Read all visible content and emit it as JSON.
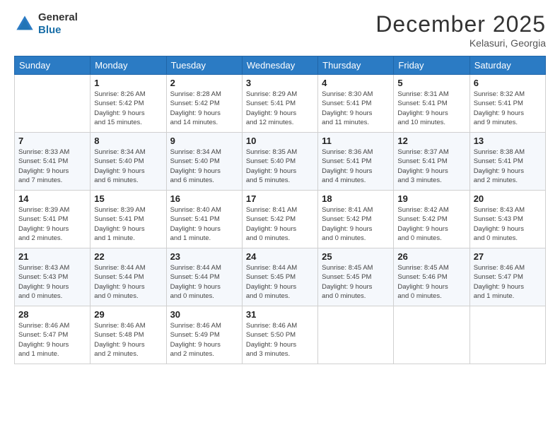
{
  "header": {
    "logo_line1": "General",
    "logo_line2": "Blue",
    "month_title": "December 2025",
    "location": "Kelasuri, Georgia"
  },
  "weekdays": [
    "Sunday",
    "Monday",
    "Tuesday",
    "Wednesday",
    "Thursday",
    "Friday",
    "Saturday"
  ],
  "weeks": [
    [
      {
        "day": "",
        "info": ""
      },
      {
        "day": "1",
        "info": "Sunrise: 8:26 AM\nSunset: 5:42 PM\nDaylight: 9 hours\nand 15 minutes."
      },
      {
        "day": "2",
        "info": "Sunrise: 8:28 AM\nSunset: 5:42 PM\nDaylight: 9 hours\nand 14 minutes."
      },
      {
        "day": "3",
        "info": "Sunrise: 8:29 AM\nSunset: 5:41 PM\nDaylight: 9 hours\nand 12 minutes."
      },
      {
        "day": "4",
        "info": "Sunrise: 8:30 AM\nSunset: 5:41 PM\nDaylight: 9 hours\nand 11 minutes."
      },
      {
        "day": "5",
        "info": "Sunrise: 8:31 AM\nSunset: 5:41 PM\nDaylight: 9 hours\nand 10 minutes."
      },
      {
        "day": "6",
        "info": "Sunrise: 8:32 AM\nSunset: 5:41 PM\nDaylight: 9 hours\nand 9 minutes."
      }
    ],
    [
      {
        "day": "7",
        "info": "Sunrise: 8:33 AM\nSunset: 5:41 PM\nDaylight: 9 hours\nand 7 minutes."
      },
      {
        "day": "8",
        "info": "Sunrise: 8:34 AM\nSunset: 5:40 PM\nDaylight: 9 hours\nand 6 minutes."
      },
      {
        "day": "9",
        "info": "Sunrise: 8:34 AM\nSunset: 5:40 PM\nDaylight: 9 hours\nand 6 minutes."
      },
      {
        "day": "10",
        "info": "Sunrise: 8:35 AM\nSunset: 5:40 PM\nDaylight: 9 hours\nand 5 minutes."
      },
      {
        "day": "11",
        "info": "Sunrise: 8:36 AM\nSunset: 5:41 PM\nDaylight: 9 hours\nand 4 minutes."
      },
      {
        "day": "12",
        "info": "Sunrise: 8:37 AM\nSunset: 5:41 PM\nDaylight: 9 hours\nand 3 minutes."
      },
      {
        "day": "13",
        "info": "Sunrise: 8:38 AM\nSunset: 5:41 PM\nDaylight: 9 hours\nand 2 minutes."
      }
    ],
    [
      {
        "day": "14",
        "info": "Sunrise: 8:39 AM\nSunset: 5:41 PM\nDaylight: 9 hours\nand 2 minutes."
      },
      {
        "day": "15",
        "info": "Sunrise: 8:39 AM\nSunset: 5:41 PM\nDaylight: 9 hours\nand 1 minute."
      },
      {
        "day": "16",
        "info": "Sunrise: 8:40 AM\nSunset: 5:41 PM\nDaylight: 9 hours\nand 1 minute."
      },
      {
        "day": "17",
        "info": "Sunrise: 8:41 AM\nSunset: 5:42 PM\nDaylight: 9 hours\nand 0 minutes."
      },
      {
        "day": "18",
        "info": "Sunrise: 8:41 AM\nSunset: 5:42 PM\nDaylight: 9 hours\nand 0 minutes."
      },
      {
        "day": "19",
        "info": "Sunrise: 8:42 AM\nSunset: 5:42 PM\nDaylight: 9 hours\nand 0 minutes."
      },
      {
        "day": "20",
        "info": "Sunrise: 8:43 AM\nSunset: 5:43 PM\nDaylight: 9 hours\nand 0 minutes."
      }
    ],
    [
      {
        "day": "21",
        "info": "Sunrise: 8:43 AM\nSunset: 5:43 PM\nDaylight: 9 hours\nand 0 minutes."
      },
      {
        "day": "22",
        "info": "Sunrise: 8:44 AM\nSunset: 5:44 PM\nDaylight: 9 hours\nand 0 minutes."
      },
      {
        "day": "23",
        "info": "Sunrise: 8:44 AM\nSunset: 5:44 PM\nDaylight: 9 hours\nand 0 minutes."
      },
      {
        "day": "24",
        "info": "Sunrise: 8:44 AM\nSunset: 5:45 PM\nDaylight: 9 hours\nand 0 minutes."
      },
      {
        "day": "25",
        "info": "Sunrise: 8:45 AM\nSunset: 5:45 PM\nDaylight: 9 hours\nand 0 minutes."
      },
      {
        "day": "26",
        "info": "Sunrise: 8:45 AM\nSunset: 5:46 PM\nDaylight: 9 hours\nand 0 minutes."
      },
      {
        "day": "27",
        "info": "Sunrise: 8:46 AM\nSunset: 5:47 PM\nDaylight: 9 hours\nand 1 minute."
      }
    ],
    [
      {
        "day": "28",
        "info": "Sunrise: 8:46 AM\nSunset: 5:47 PM\nDaylight: 9 hours\nand 1 minute."
      },
      {
        "day": "29",
        "info": "Sunrise: 8:46 AM\nSunset: 5:48 PM\nDaylight: 9 hours\nand 2 minutes."
      },
      {
        "day": "30",
        "info": "Sunrise: 8:46 AM\nSunset: 5:49 PM\nDaylight: 9 hours\nand 2 minutes."
      },
      {
        "day": "31",
        "info": "Sunrise: 8:46 AM\nSunset: 5:50 PM\nDaylight: 9 hours\nand 3 minutes."
      },
      {
        "day": "",
        "info": ""
      },
      {
        "day": "",
        "info": ""
      },
      {
        "day": "",
        "info": ""
      }
    ]
  ]
}
